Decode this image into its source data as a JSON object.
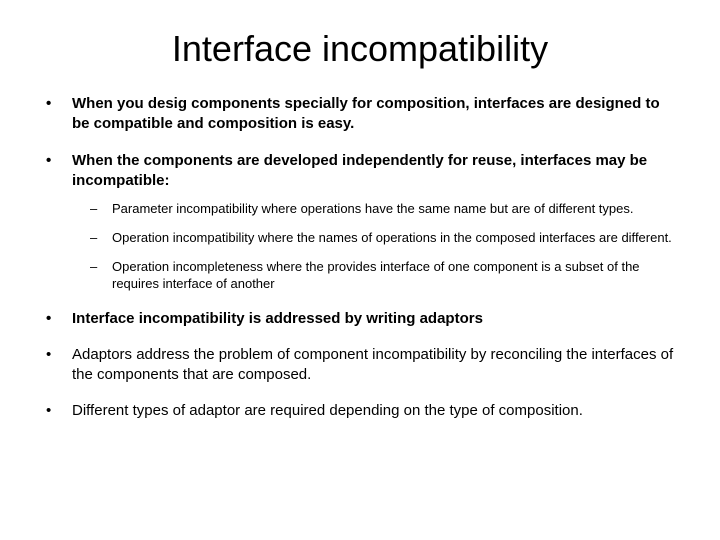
{
  "title": "Interface incompatibility",
  "bullets": [
    {
      "text": "When you desig components specially for composition, interfaces are designed to be compatible and composition is easy.",
      "bold": true
    },
    {
      "text": "When the components are developed independently for reuse, interfaces may be incompatible:",
      "bold": true,
      "sub": [
        "Parameter incompatibility where operations have the same name but are of different types.",
        "Operation incompatibility where the names of operations in the composed interfaces are different.",
        "Operation incompleteness where the provides interface of one component is a subset of the requires interface of another"
      ]
    },
    {
      "text": "Interface incompatibility is addressed by writing adaptors",
      "bold": true
    },
    {
      "text": "Adaptors address the problem of component incompatibility by reconciling the interfaces of the components that are composed.",
      "bold": false
    },
    {
      "text": "Different types of adaptor are required depending on the type of composition.",
      "bold": false
    }
  ]
}
